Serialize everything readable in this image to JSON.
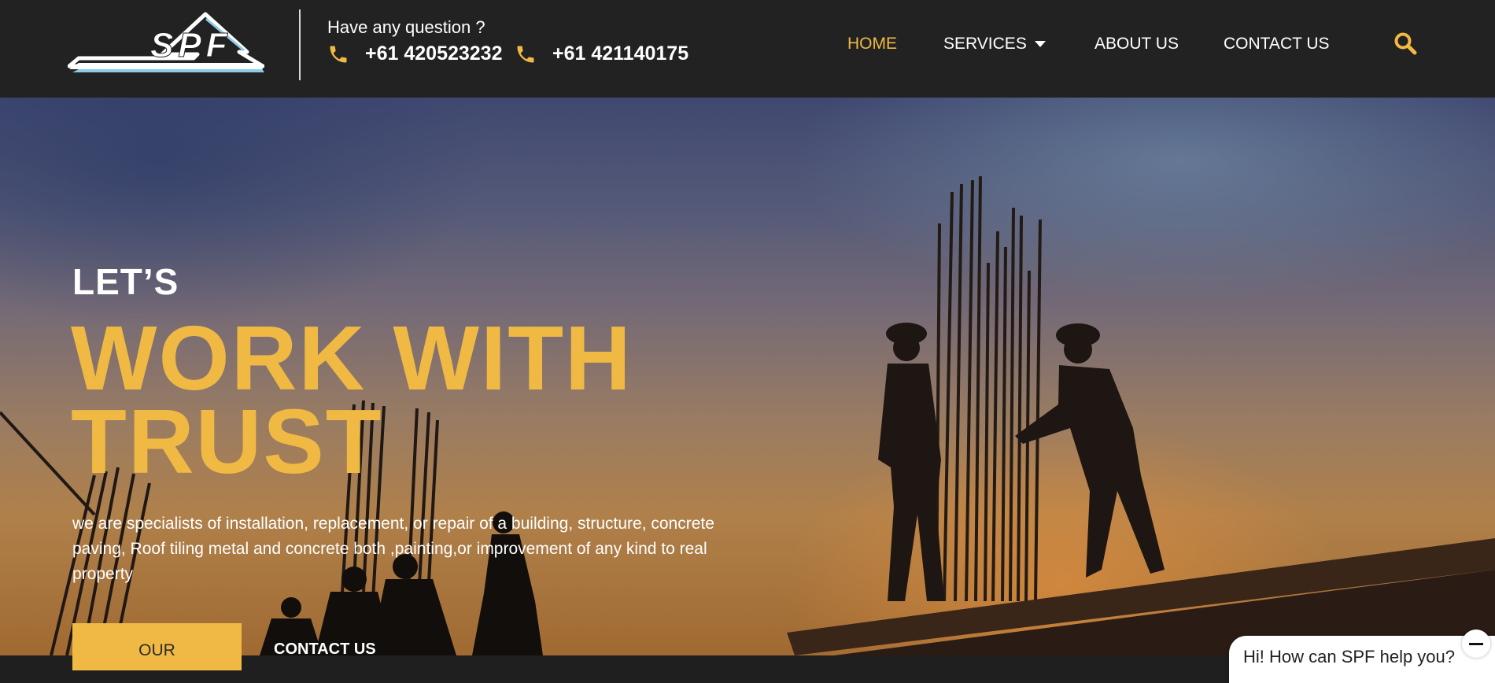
{
  "brand": {
    "logo_text": "SPF"
  },
  "contact_bar": {
    "question": "Have any question ?",
    "phones": [
      "+61 420523232",
      "+61 421140175"
    ]
  },
  "nav": {
    "items": [
      {
        "label": "HOME",
        "active": true
      },
      {
        "label": "SERVICES",
        "active": false,
        "has_dropdown": true
      },
      {
        "label": "ABOUT US",
        "active": false
      },
      {
        "label": "CONTACT US",
        "active": false
      }
    ],
    "search_icon": "search-icon"
  },
  "hero": {
    "kicker": "LET’S",
    "headline_line1": "WORK WITH",
    "headline_line2": "TRUST",
    "description": "we are specialists of installation, replacement, or repair of a building, structure, concrete paving, Roof  tiling metal and concrete both ,painting,or improvement of any kind to real property",
    "primary_button": "OUR",
    "secondary_button": "CONTACT US"
  },
  "chat_widget": {
    "message": "Hi! How can SPF help you?",
    "minimize_icon": "minus-icon"
  },
  "colors": {
    "header_bg": "#222222",
    "accent": "#f0b944",
    "text_light": "#ffffff"
  }
}
